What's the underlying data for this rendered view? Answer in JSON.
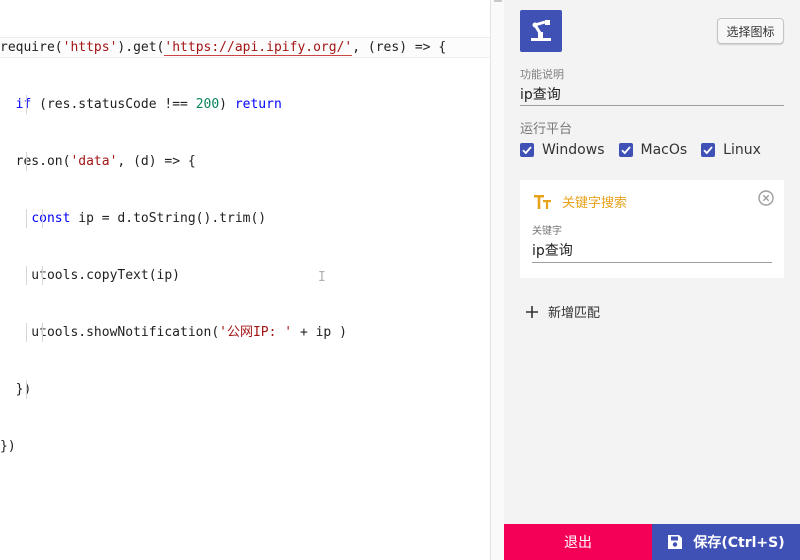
{
  "editor": {
    "lines": [
      [
        "require(",
        "'https'",
        ").get(",
        "'https://api.ipify.org/'",
        ", (res) => {"
      ],
      [
        "  ",
        "if",
        " (res.statusCode !== ",
        "200",
        ") ",
        "return"
      ],
      [
        "  res.on(",
        "'data'",
        ", (d) => {"
      ],
      [
        "    ",
        "const",
        " ip = d.toString().trim()"
      ],
      [
        "    utools.copyText(ip)"
      ],
      [
        "    utools.showNotification(",
        "'公网IP: '",
        " + ip )"
      ],
      [
        "  })"
      ],
      [
        "})"
      ]
    ],
    "cursor_glyph": "I"
  },
  "panel": {
    "app_icon": "robot-arm-icon",
    "choose_icon_label": "选择图标",
    "description_label": "功能说明",
    "description_value": "ip查询",
    "platform_title": "运行平台",
    "platforms": [
      {
        "name": "Windows",
        "checked": true
      },
      {
        "name": "MacOs",
        "checked": true
      },
      {
        "name": "Linux",
        "checked": true
      }
    ],
    "keyword_card": {
      "icon": "text-size-icon",
      "title": "关键字搜索",
      "keyword_label": "关键字",
      "keyword_value": "ip查询"
    },
    "add_match_label": "新增匹配"
  },
  "footer": {
    "exit_label": "退出",
    "save_label": "保存(Ctrl+S)"
  },
  "colors": {
    "primary": "#3f51b5",
    "danger": "#f50057",
    "accent": "#e8a21b"
  }
}
